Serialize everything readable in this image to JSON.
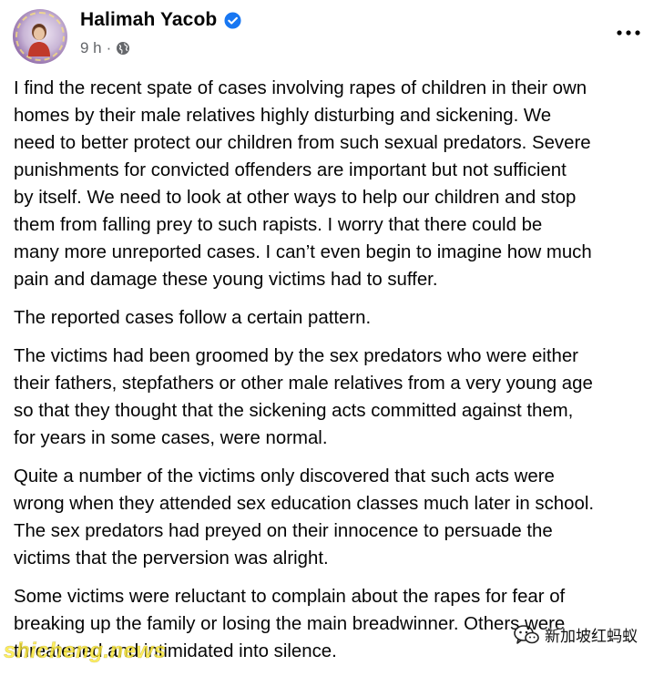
{
  "post": {
    "author_name": "Halimah Yacob",
    "timestamp": "9 h",
    "separator": "·",
    "audience_icon": "globe-icon",
    "verified_icon": "verified-badge-icon",
    "more_icon": "more-options-icon",
    "paragraphs": [
      "I find the recent spate of cases involving rapes of children in their own\nhomes by their male relatives highly disturbing and sickening. We\nneed to better protect our children from such sexual predators. Severe\npunishments for convicted offenders are important but not sufficient\nby itself. We need to look at other ways to help our children and stop\nthem from falling prey to such rapists. I worry that there could be\nmany more unreported cases. I can’t even begin to imagine how much\npain and damage these young victims had to suffer.",
      "The reported cases follow a certain pattern.",
      "The victims had been groomed by the sex predators who were either\ntheir fathers, stepfathers or other male relatives from a very young age\nso that they thought that the sickening acts committed against them,\nfor years in some cases, were normal.",
      "Quite a number of the victims only discovered that such acts were\nwrong when they attended sex education classes much later in school.\nThe sex predators had preyed on their innocence to persuade the\nvictims that the perversion was alright.",
      "Some victims were reluctant to complain about the rapes for fear of\nbreaking up the family or losing the main breadwinner. Others were\nthreatened and intimidated into silence."
    ]
  },
  "watermarks": {
    "left_text": "shicheng.news",
    "right_text": "新加坡红蚂蚁",
    "right_icon": "wechat-icon"
  },
  "colors": {
    "text_primary": "#050505",
    "text_secondary": "#65676b",
    "verified_blue": "#1877f2",
    "watermark_yellow": "#ffeb3c"
  }
}
